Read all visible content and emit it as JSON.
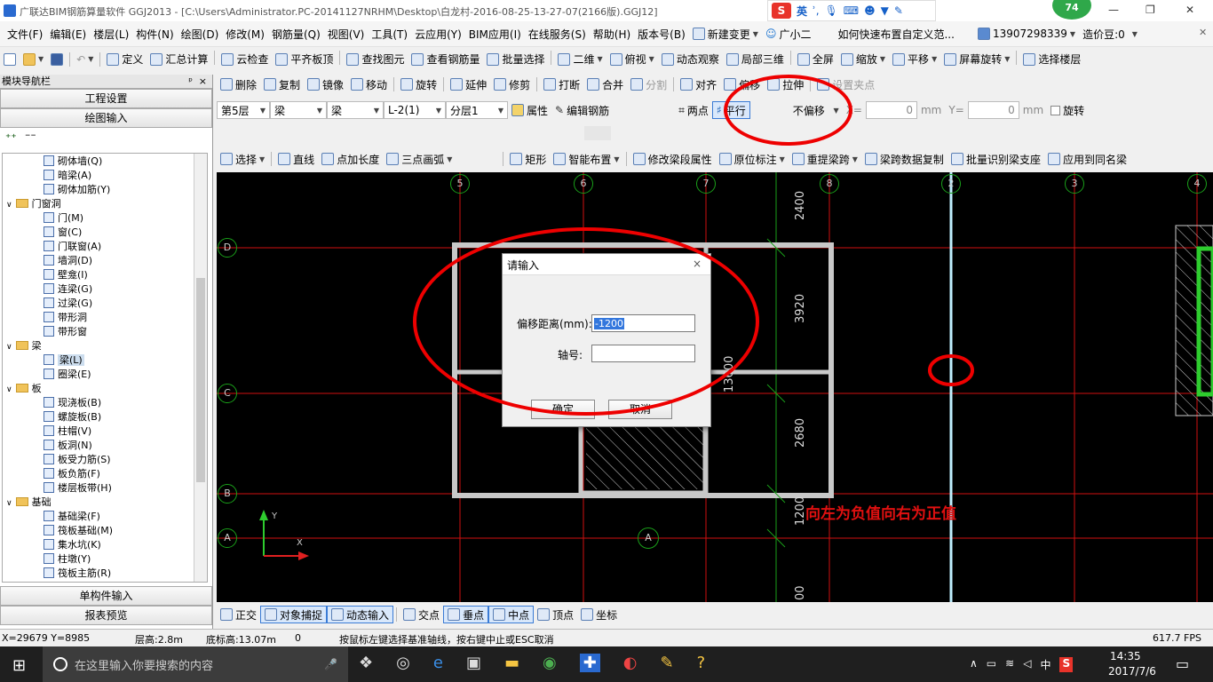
{
  "titlebar": {
    "app_title": "广联达BIM钢筋算量软件 GGJ2013 - [C:\\Users\\Administrator.PC-20141127NRHM\\Desktop\\白龙村-2016-08-25-13-27-07(2166版).GGJ12]",
    "ime_label": "英",
    "badge": "74",
    "minimize": "—",
    "restore": "❐",
    "close": "✕"
  },
  "menubar": {
    "items": [
      "文件(F)",
      "编辑(E)",
      "楼层(L)",
      "构件(N)",
      "绘图(D)",
      "修改(M)",
      "钢筋量(Q)",
      "视图(V)",
      "工具(T)",
      "云应用(Y)",
      "BIM应用(I)",
      "在线服务(S)",
      "帮助(H)",
      "版本号(B)"
    ],
    "new_change": "新建变更",
    "assistant": "广小二",
    "help_link": "如何快速布置自定义范...",
    "phone": "13907298339",
    "score": "造价豆:0"
  },
  "toolbar1": {
    "items": [
      "定义",
      "汇总计算",
      "云检查",
      "平齐板顶",
      "查找图元",
      "查看钢筋量",
      "批量选择",
      "二维",
      "俯视",
      "动态观察",
      "局部三维",
      "全屏",
      "缩放",
      "平移",
      "屏幕旋转",
      "选择楼层"
    ]
  },
  "toolbar2": {
    "items": [
      "删除",
      "复制",
      "镜像",
      "移动",
      "旋转",
      "延伸",
      "修剪",
      "打断",
      "合并",
      "分割",
      "对齐",
      "偏移",
      "拉伸",
      "设置夹点"
    ]
  },
  "toolbar3": {
    "floor": "第5层",
    "type1": "梁",
    "type2": "梁",
    "component": "L-2(1)",
    "layer": "分层1",
    "props": "属性",
    "edit_rebar": "编辑钢筋",
    "two_point": "两点",
    "parallel": "平行",
    "offset_mode": "不偏移",
    "x_label": "X=",
    "x_val": "0",
    "y_label": "Y=",
    "y_val": "0",
    "unit": "mm",
    "rotate": "旋转"
  },
  "toolbar4": {
    "items": [
      "选择",
      "直线",
      "点加长度",
      "三点画弧",
      "矩形",
      "智能布置",
      "修改梁段属性",
      "原位标注",
      "重提梁跨",
      "梁跨数据复制",
      "批量识别梁支座",
      "应用到同名梁"
    ]
  },
  "sidebar": {
    "title": "模块导航栏",
    "pin": "ᵖ",
    "close": "×",
    "btn_setup": "工程设置",
    "btn_draw": "绘图输入",
    "tree": [
      {
        "t": "item",
        "label": "砌体墙(Q)"
      },
      {
        "t": "item",
        "label": "暗梁(A)"
      },
      {
        "t": "item",
        "label": "砌体加筋(Y)"
      },
      {
        "t": "folder",
        "label": "门窗洞"
      },
      {
        "t": "item",
        "label": "门(M)"
      },
      {
        "t": "item",
        "label": "窗(C)"
      },
      {
        "t": "item",
        "label": "门联窗(A)"
      },
      {
        "t": "item",
        "label": "墙洞(D)"
      },
      {
        "t": "item",
        "label": "壁龛(I)"
      },
      {
        "t": "item",
        "label": "连梁(G)"
      },
      {
        "t": "item",
        "label": "过梁(G)"
      },
      {
        "t": "item",
        "label": "带形洞"
      },
      {
        "t": "item",
        "label": "带形窗"
      },
      {
        "t": "folder",
        "label": "梁"
      },
      {
        "t": "item",
        "label": "梁(L)",
        "sel": true
      },
      {
        "t": "item",
        "label": "圈梁(E)"
      },
      {
        "t": "folder",
        "label": "板"
      },
      {
        "t": "item",
        "label": "现浇板(B)"
      },
      {
        "t": "item",
        "label": "螺旋板(B)"
      },
      {
        "t": "item",
        "label": "柱帽(V)"
      },
      {
        "t": "item",
        "label": "板洞(N)"
      },
      {
        "t": "item",
        "label": "板受力筋(S)"
      },
      {
        "t": "item",
        "label": "板负筋(F)"
      },
      {
        "t": "item",
        "label": "楼层板带(H)"
      },
      {
        "t": "folder",
        "label": "基础"
      },
      {
        "t": "item",
        "label": "基础梁(F)"
      },
      {
        "t": "item",
        "label": "筏板基础(M)"
      },
      {
        "t": "item",
        "label": "集水坑(K)"
      },
      {
        "t": "item",
        "label": "柱墩(Y)"
      },
      {
        "t": "item",
        "label": "筏板主筋(R)"
      }
    ],
    "btn_single": "单构件输入",
    "btn_report": "报表预览"
  },
  "canvas": {
    "axes_top": [
      "5",
      "6",
      "7",
      "8",
      "2",
      "3",
      "4"
    ],
    "axes_left": [
      "D",
      "C",
      "B",
      "A"
    ],
    "axis_bottom_a": "A",
    "dims": [
      "2400",
      "3920",
      "2680",
      "1200",
      "00"
    ],
    "dim_total": "13600",
    "annotation": "向左为负值向右为正值",
    "y_axis": "Y",
    "x_axis": "X"
  },
  "dialog": {
    "title": "请输入",
    "close": "×",
    "offset_label": "偏移距离(mm):",
    "offset_value": "-1200",
    "axis_label": "轴号:",
    "axis_value": "",
    "ok": "确定",
    "cancel": "取消"
  },
  "bottombar": {
    "items": [
      "正交",
      "对象捕捉",
      "动态输入",
      "交点",
      "垂点",
      "中点",
      "顶点",
      "坐标"
    ]
  },
  "statusbar": {
    "coords": "X=29679 Y=8985",
    "floor_height": "层高:2.8m",
    "bottom_height": "底标高:13.07m",
    "zero": "0",
    "hint": "按鼠标左键选择基准轴线，按右键中止或ESC取消",
    "fps": "617.7 FPS"
  },
  "taskbar": {
    "search_placeholder": "在这里输入你要搜索的内容",
    "time": "14:35",
    "date": "2017/7/6",
    "lang": "中"
  }
}
